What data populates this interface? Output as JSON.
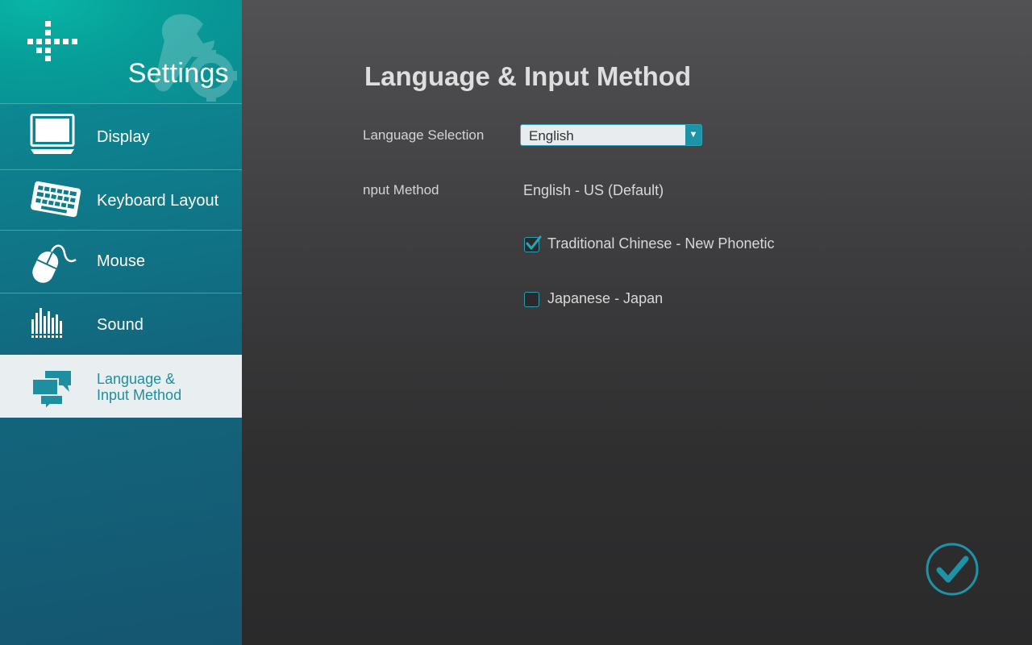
{
  "sidebar": {
    "title": "Settings",
    "items": [
      {
        "id": "display",
        "label": "Display",
        "icon": "monitor-icon",
        "active": false
      },
      {
        "id": "keyboard",
        "label": "Keyboard  Layout",
        "icon": "keyboard-icon",
        "active": false
      },
      {
        "id": "mouse",
        "label": "Mouse",
        "icon": "mouse-icon",
        "active": false
      },
      {
        "id": "sound",
        "label": "Sound",
        "icon": "equalizer-icon",
        "active": false
      },
      {
        "id": "language",
        "label_line1": "Language &",
        "label_line2": "Input Method",
        "icon": "chat-bubbles-icon",
        "active": true
      }
    ]
  },
  "main": {
    "title": "Language & Input Method",
    "language_selection": {
      "label": "Language Selection",
      "value": "English"
    },
    "input_method": {
      "label": "nput Method",
      "value": "English - US (Default)",
      "options": [
        {
          "label": "Traditional Chinese - New Phonetic",
          "checked": true
        },
        {
          "label": "Japanese - Japan",
          "checked": false
        }
      ]
    },
    "confirm_icon": "checkmark-circle-icon"
  },
  "colors": {
    "accent": "#1e93a8",
    "sidebar_top": "#07a29a",
    "sidebar_bottom": "#15556f",
    "active_item_bg": "#e9eff0",
    "active_item_text": "#1d8fa0",
    "main_bg": "#3a3a3b"
  }
}
